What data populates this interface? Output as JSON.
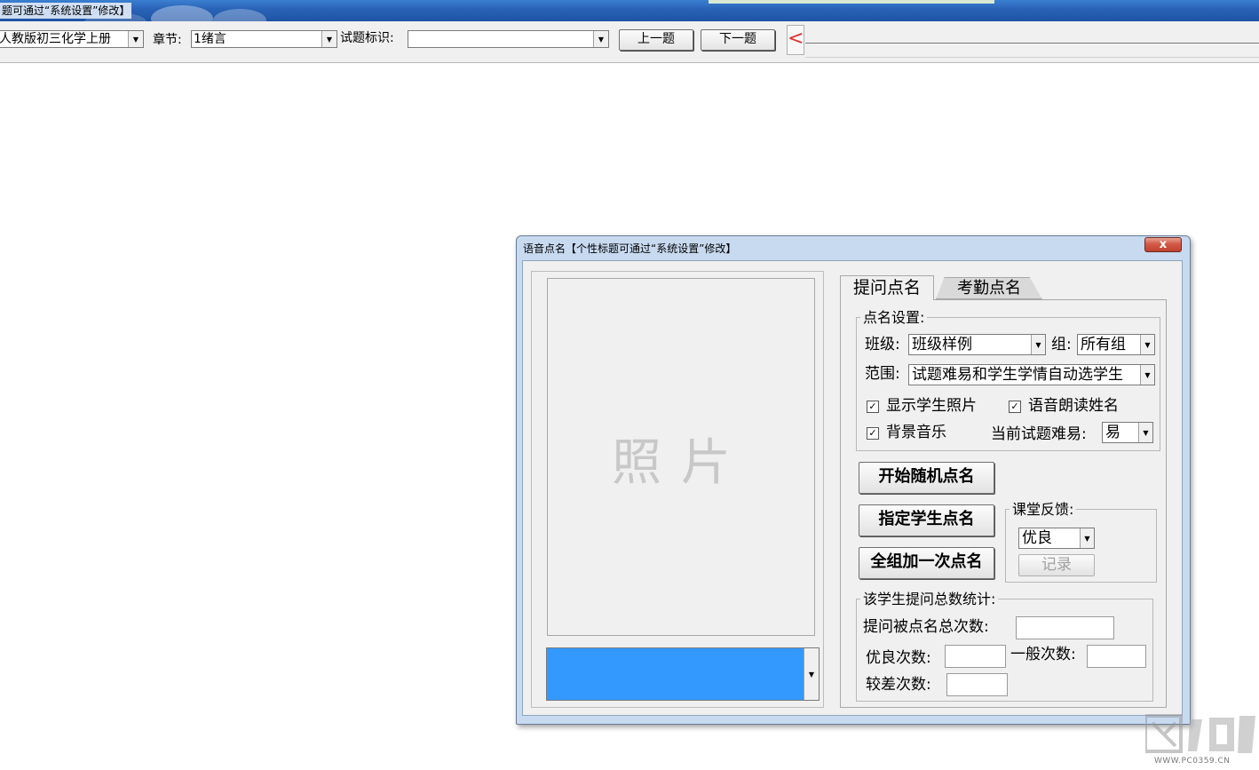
{
  "window": {
    "title": "题可通过“系统设置”修改】"
  },
  "toolbar": {
    "textbook": "人教版初三化学上册",
    "chapter_label": "章节:",
    "chapter_value": "1绪言",
    "question_id_label": "试题标识:",
    "question_id_value": "",
    "prev_label": "上一题",
    "next_label": "下一题",
    "collapse_glyph": "<"
  },
  "dialog": {
    "title": "语音点名【个性标题可通过“系统设置”修改】",
    "close_glyph": "x",
    "photo_label": "照片",
    "tabs": [
      {
        "label": "提问点名",
        "active": true
      },
      {
        "label": "考勤点名",
        "active": false
      }
    ],
    "settings": {
      "group_label": "点名设置:",
      "class_label": "班级:",
      "class_value": "班级样例",
      "group_field_label": "组:",
      "group_value": "所有组",
      "range_label": "范围:",
      "range_value": "试题难易和学生学情自动选学生",
      "show_photo": {
        "label": "显示学生照片",
        "checked": true
      },
      "voice_read": {
        "label": "语音朗读姓名",
        "checked": true
      },
      "bg_music": {
        "label": "背景音乐",
        "checked": true
      },
      "difficulty_label": "当前试题难易:",
      "difficulty_value": "易",
      "check_glyph": "✓"
    },
    "buttons": {
      "start_random": "开始随机点名",
      "designate": "指定学生点名",
      "group_once": "全组加一次点名"
    },
    "feedback": {
      "group_label": "课堂反馈:",
      "value": "优良",
      "record_label": "记录"
    },
    "stats": {
      "group_label": "该学生提问总数统计:",
      "total_label": "提问被点名总次数:",
      "good_label": "优良次数:",
      "normal_label": "一般次数:",
      "poor_label": "较差次数:"
    }
  },
  "watermark": {
    "text": "WWW.PC0359.CN"
  },
  "colors": {
    "titlebar": "#2a64b8",
    "dialog_frame": "#c7daf0",
    "selection": "#3399ff",
    "close": "#c04130"
  }
}
